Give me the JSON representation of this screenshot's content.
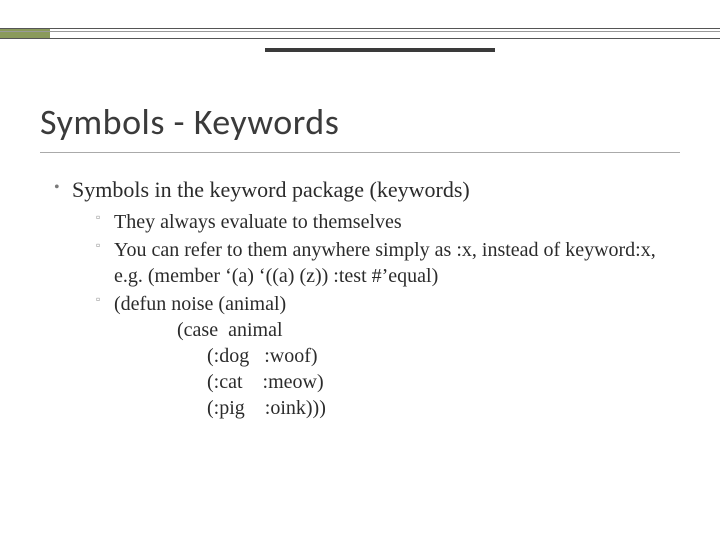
{
  "decor": {
    "accent_color": "#8a9a5b"
  },
  "title": "Symbols - Keywords",
  "bullets": {
    "lvl1_0": "Symbols in the keyword package (keywords)",
    "lvl2_0": "They always evaluate to themselves",
    "lvl2_1": "You can refer to them anywhere simply as :x, instead of keyword:x, e.g. (member ‘(a) ‘((a) (z)) :test #’equal)",
    "lvl2_2": "(defun  noise  (animal)",
    "code_l1": "         (case  animal",
    "code_l2": "               (:dog   :woof)",
    "code_l3": "               (:cat    :meow)",
    "code_l4": "               (:pig    :oink)))"
  }
}
